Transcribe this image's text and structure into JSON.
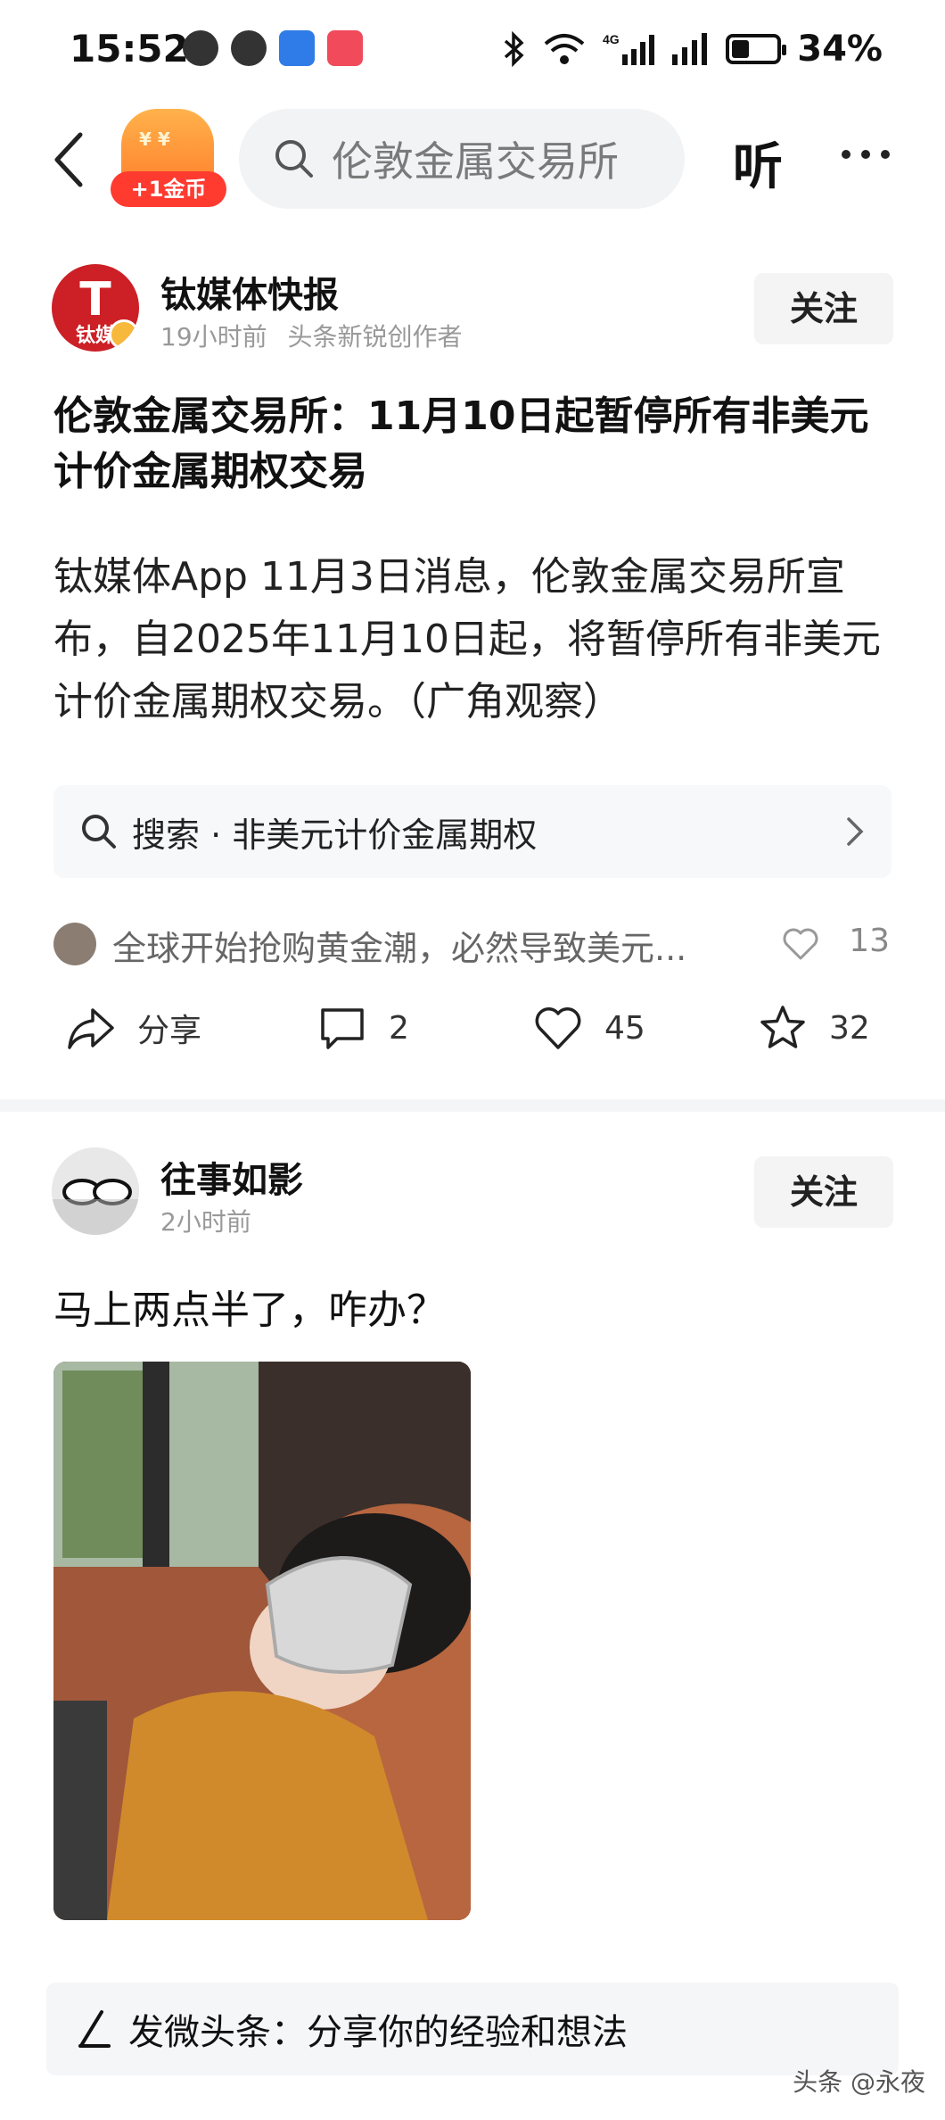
{
  "status_bar": {
    "time": "15:52",
    "battery": "34%",
    "battery_level": 0.34
  },
  "header": {
    "coin_badge": "+1金币",
    "search_placeholder": "伦敦金属交易所",
    "listen_label": "听"
  },
  "post1": {
    "author": "钛媒体快报",
    "avatar_letter": "T",
    "avatar_text": "钛媒",
    "time": "19小时前",
    "creator_tag": "头条新锐创作者",
    "follow_label": "关注",
    "title": "伦敦金属交易所：11月10日起暂停所有非美元计价金属期权交易",
    "body": "钛媒体App 11月3日消息，伦敦金属交易所宣布，自2025年11月10日起，将暂停所有非美元计价金属期权交易。（广角观察）",
    "related_search": "搜索 · 非美元计价金属期权",
    "top_comment": "全球开始抢购黄金潮，必然导致美元...",
    "top_comment_likes": "13",
    "share_label": "分享",
    "comments": "2",
    "likes": "45",
    "favorites": "32"
  },
  "post2": {
    "author": "往事如影",
    "time": "2小时前",
    "follow_label": "关注",
    "text": "马上两点半了，咋办？"
  },
  "compose": {
    "placeholder": "发微头条：分享你的经验和想法"
  },
  "watermark": "头条 @永夜"
}
